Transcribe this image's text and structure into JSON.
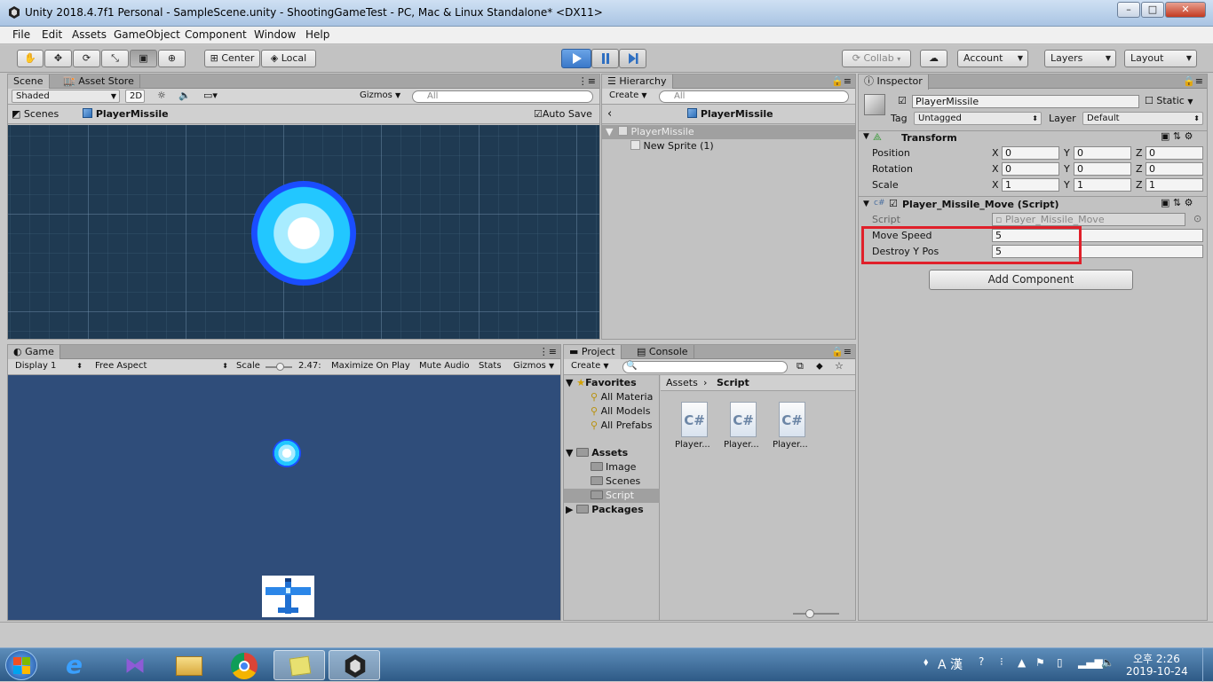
{
  "window": {
    "title": "Unity 2018.4.7f1 Personal - SampleScene.unity - ShootingGameTest - PC, Mac & Linux Standalone* <DX11>",
    "btn_min": "–",
    "btn_max": "□",
    "btn_close": "✕"
  },
  "menu": [
    "File",
    "Edit",
    "Assets",
    "GameObject",
    "Component",
    "Window",
    "Help"
  ],
  "toolbar": {
    "center": "Center",
    "local": "Local",
    "collab": "Collab",
    "account": "Account",
    "layers": "Layers",
    "layout": "Layout"
  },
  "scene": {
    "tab": "Scene",
    "tab2": "Asset Store",
    "shaded": "Shaded",
    "btn2d": "2D",
    "gizmos": "Gizmos",
    "search": "All",
    "breadcrumb": "Scenes",
    "object": "PlayerMissile",
    "autosave": "Auto Save"
  },
  "hierarchy": {
    "tab": "Hierarchy",
    "create": "Create",
    "search": "All",
    "header": "PlayerMissile",
    "root": "PlayerMissile",
    "child": "New Sprite (1)"
  },
  "inspector": {
    "tab": "Inspector",
    "name": "PlayerMissile",
    "static": "Static",
    "tag_label": "Tag",
    "tag": "Untagged",
    "layer_label": "Layer",
    "layer": "Default",
    "transform": {
      "title": "Transform",
      "rows": [
        {
          "label": "Position",
          "x": "0",
          "y": "0",
          "z": "0"
        },
        {
          "label": "Rotation",
          "x": "0",
          "y": "0",
          "z": "0"
        },
        {
          "label": "Scale",
          "x": "1",
          "y": "1",
          "z": "1"
        }
      ]
    },
    "script": {
      "title": "Player_Missile_Move (Script)",
      "script_label": "Script",
      "script_value": "Player_Missile_Move",
      "fields": [
        {
          "label": "Move Speed",
          "value": "5"
        },
        {
          "label": "Destroy Y Pos",
          "value": "5"
        }
      ]
    },
    "add_component": "Add Component",
    "highlight_color": "#e0202a"
  },
  "game": {
    "tab": "Game",
    "display": "Display 1",
    "aspect": "Free Aspect",
    "scale_label": "Scale",
    "scale_value": "2.47:",
    "maximize": "Maximize On Play",
    "mute": "Mute Audio",
    "stats": "Stats",
    "gizmos": "Gizmos"
  },
  "project": {
    "tab": "Project",
    "tab2": "Console",
    "create": "Create",
    "favorites": "Favorites",
    "fav_items": [
      "All Materia",
      "All Models",
      "All Prefabs"
    ],
    "assets": "Assets",
    "asset_items": [
      "Image",
      "Scenes",
      "Script"
    ],
    "packages": "Packages",
    "breadcrumb_root": "Assets",
    "breadcrumb_leaf": "Script",
    "files": [
      "Player...",
      "Player...",
      "Player..."
    ],
    "file_icon": "C#"
  },
  "taskbar": {
    "ime": "A 漢",
    "time": "오후 2:26",
    "date": "2019-10-24"
  },
  "colors": {
    "scene_bg": "#1f3a52",
    "game_bg": "#2f4d7a",
    "accent": "#3a78c9"
  }
}
